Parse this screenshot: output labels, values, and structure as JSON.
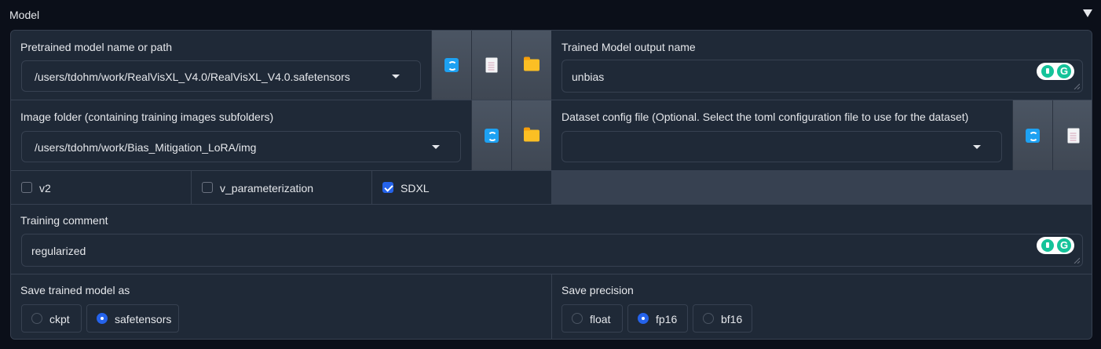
{
  "section": {
    "title": "Model"
  },
  "pretrained": {
    "label": "Pretrained model name or path",
    "value": "/users/tdohm/work/RealVisXL_V4.0/RealVisXL_V4.0.safetensors"
  },
  "output_name": {
    "label": "Trained Model output name",
    "value": "unbias"
  },
  "image_folder": {
    "label": "Image folder (containing training images subfolders)",
    "value": "/users/tdohm/work/Bias_Mitigation_LoRA/img"
  },
  "dataset_config": {
    "label": "Dataset config file (Optional. Select the toml configuration file to use for the dataset)",
    "value": ""
  },
  "checkboxes": [
    {
      "label": "v2",
      "checked": false
    },
    {
      "label": "v_parameterization",
      "checked": false
    },
    {
      "label": "SDXL",
      "checked": true
    }
  ],
  "training_comment": {
    "label": "Training comment",
    "value": "regularized"
  },
  "save_model_as": {
    "label": "Save trained model as",
    "options": [
      "ckpt",
      "safetensors"
    ],
    "selected": "safetensors"
  },
  "save_precision": {
    "label": "Save precision",
    "options": [
      "float",
      "fp16",
      "bf16"
    ],
    "selected": "fp16"
  },
  "colors": {
    "accent": "#2563eb",
    "panel": "#1f2937",
    "border": "#374151",
    "page": "#0b0f19"
  }
}
